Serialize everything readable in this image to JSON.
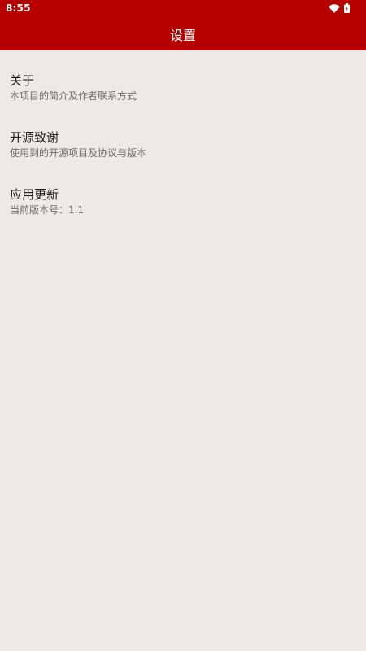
{
  "status_bar": {
    "time": "8:55",
    "icons": [
      "wifi-icon",
      "battery-icon"
    ]
  },
  "app_bar": {
    "title": "设置"
  },
  "settings": {
    "items": [
      {
        "title": "关于",
        "subtitle": "本项目的简介及作者联系方式"
      },
      {
        "title": "开源致谢",
        "subtitle": "使用到的开源项目及协议与版本"
      },
      {
        "title": "应用更新",
        "subtitle": "当前版本号：1.1"
      }
    ]
  },
  "colors": {
    "primary": "#b60000",
    "background": "#f0e8e7",
    "title_text": "#1c1b1b",
    "subtitle_text": "#6f6b6a"
  }
}
